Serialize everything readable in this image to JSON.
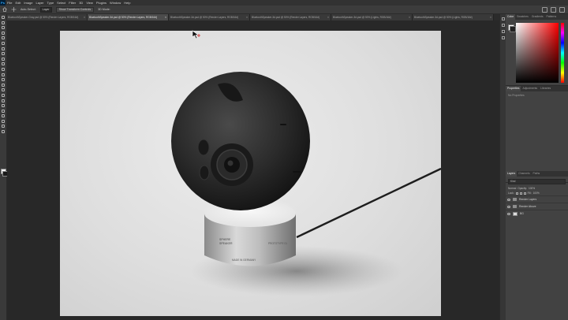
{
  "app": {
    "logo": "Ps"
  },
  "menu": [
    "File",
    "Edit",
    "Image",
    "Layer",
    "Type",
    "Select",
    "Filter",
    "3D",
    "View",
    "Plugins",
    "Window",
    "Help"
  ],
  "options_bar": {
    "home_icon": "home-icon",
    "tool_icon": "move-tool-icon",
    "auto_select_label": "Auto-Select:",
    "auto_select_value": "Layer",
    "transform_controls": "Show Transform Controls",
    "mode_3d": "3D Mode:",
    "right_icons": [
      "search-icon",
      "workspace-icon",
      "share-icon"
    ]
  },
  "tabs": [
    {
      "label": "BluetoothSpeaker-Gray.psd @ 50% (Render Layers, RGB/16#)",
      "active": false
    },
    {
      "label": "BluetoothSpeaker-3d.psd @ 50% (Render Layers, RGB/16#)",
      "active": true
    },
    {
      "label": "BluetoothSpeaker-3d.psd @ 50% (Render Layers, RGB/16#)",
      "active": false
    },
    {
      "label": "BluetoothSpeaker-3d.psd @ 50% (Render Layers, RGB/16#)",
      "active": false
    },
    {
      "label": "BluetoothSpeaker-3d.psd @ 50% (Lights, RGB/16#)",
      "active": false
    },
    {
      "label": "BluetoothSpeaker-3d.psd @ 50% (Lights, RGB/16#)",
      "active": false
    }
  ],
  "tab_close": "×",
  "toolbar_icons": [
    "move-tool-icon",
    "artboard-icon",
    "marquee-icon",
    "lasso-icon",
    "quick-select-icon",
    "crop-icon",
    "frame-icon",
    "eyedropper-icon",
    "healing-icon",
    "brush-icon",
    "clone-stamp-icon",
    "history-brush-icon",
    "eraser-icon",
    "gradient-icon",
    "blur-icon",
    "dodge-icon",
    "pen-icon",
    "type-icon",
    "path-select-icon",
    "shape-icon",
    "hand-icon",
    "zoom-icon",
    "more-tools-icon",
    "edit-toolbar-icon"
  ],
  "colors": {
    "foreground": "#f5f5f5",
    "background": "#1a1a1a"
  },
  "color_panel": {
    "tabs": [
      "Color",
      "Swatches",
      "Gradients",
      "Patterns"
    ],
    "active": "Color"
  },
  "properties_panel": {
    "tabs": [
      "Properties",
      "Adjustments",
      "Libraries"
    ],
    "active": "Properties",
    "empty_text": "No Properties"
  },
  "layers_panel": {
    "tabs": [
      "Layers",
      "Channels",
      "Paths"
    ],
    "active": "Layers",
    "search_placeholder": "Kind",
    "blend_mode": "Normal",
    "opacity_label": "Opacity:",
    "opacity_value": "100%",
    "lock_label": "Lock:",
    "fill_label": "Fill:",
    "fill_value": "100%",
    "layers": [
      {
        "name": "Render Layers",
        "type": "group"
      },
      {
        "name": "Render Above",
        "type": "group"
      },
      {
        "name": "BG",
        "type": "layer"
      }
    ]
  },
  "canvas": {
    "subject": "spherical bluetooth speaker on cylindrical aluminium base",
    "base_label_lines": [
      "SPHERE",
      "SPEAKER",
      "MADE IN GERMANY"
    ],
    "base_label_right": "PROTOTYPE 01"
  }
}
